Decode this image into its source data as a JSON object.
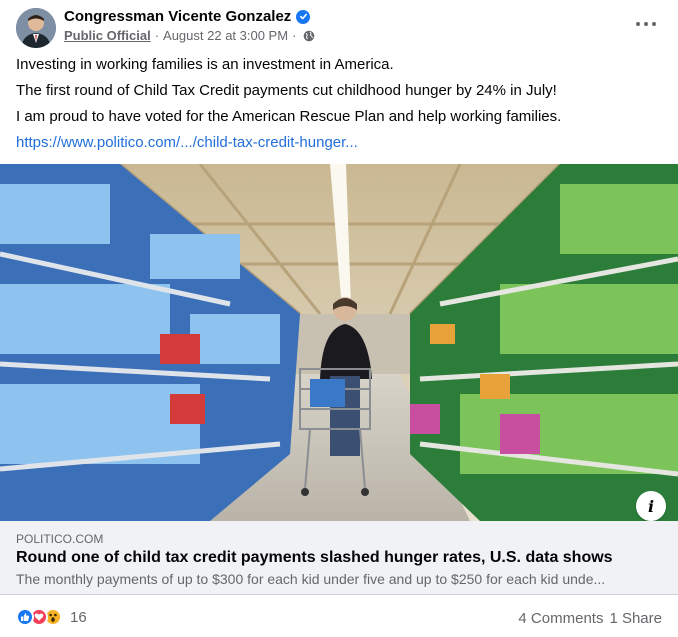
{
  "post": {
    "author": "Congressman Vicente Gonzalez",
    "role": "Public Official",
    "separator": "·",
    "date": "August 22 at 3:00 PM",
    "audience_icon": "globe-icon",
    "verified_icon": "verified-badge-icon",
    "menu_icon": "more-options-icon"
  },
  "body": {
    "lines": [
      "Investing in working families is an investment in America.",
      "The first round of Child Tax Credit payments cut childhood hunger by 24% in July!",
      "I am proud to have voted for the American Rescue Plan and help working families."
    ],
    "link": "https://www.politico.com/.../child-tax-credit-hunger..."
  },
  "link_preview": {
    "domain": "POLITICO.COM",
    "headline": "Round one of child tax credit payments slashed hunger rates, U.S. data shows",
    "description": "The monthly payments of up to $300 for each kid under five and up to $250 for each kid unde...",
    "info_label": "i"
  },
  "engagement": {
    "reaction_icons": [
      "like-icon",
      "love-icon",
      "wow-icon"
    ],
    "reaction_count": "16",
    "comments": "4 Comments",
    "shares": "1 Share"
  },
  "colors": {
    "link": "#216fdb",
    "secondary_text": "#65676b",
    "card_bg": "#f0f2f5",
    "like": "#1877f2",
    "love": "#f33e58",
    "wow": "#f7b125"
  }
}
